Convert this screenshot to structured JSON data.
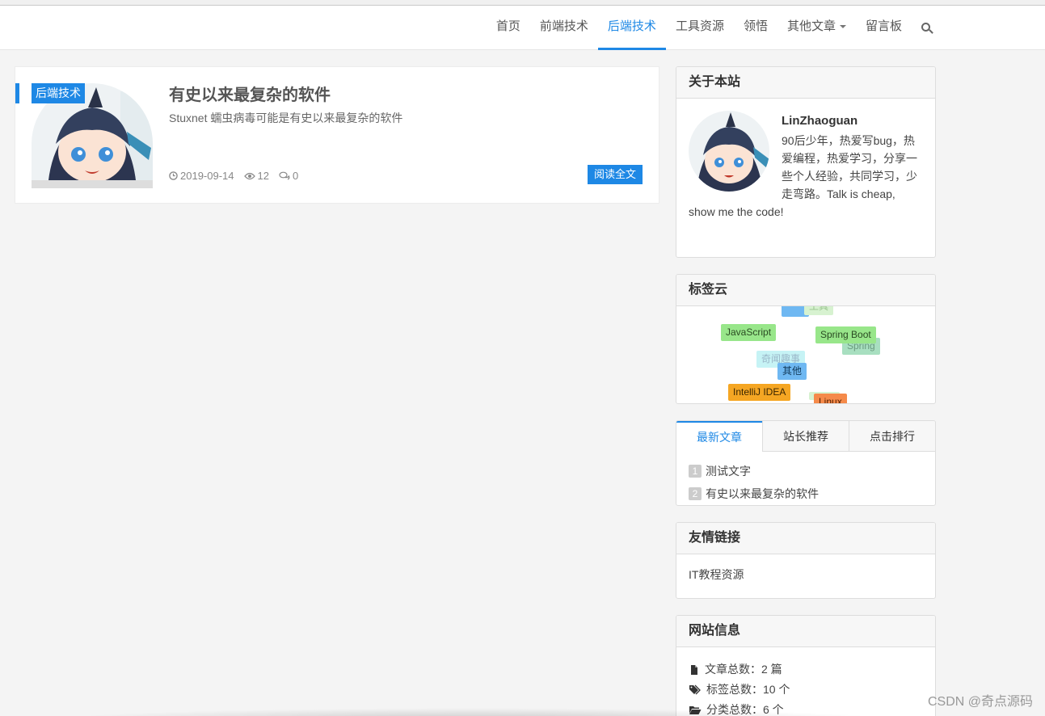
{
  "nav": {
    "items": [
      {
        "label": "首页",
        "active": false
      },
      {
        "label": "前端技术",
        "active": false
      },
      {
        "label": "后端技术",
        "active": true
      },
      {
        "label": "工具资源",
        "active": false
      },
      {
        "label": "领悟",
        "active": false
      },
      {
        "label": "其他文章",
        "active": false,
        "dropdown": true
      },
      {
        "label": "留言板",
        "active": false
      }
    ],
    "search_icon": "search-icon"
  },
  "article": {
    "category": "后端技术",
    "title": "有史以来最复杂的软件",
    "description": "Stuxnet 蠕虫病毒可能是有史以来最复杂的软件",
    "date": "2019-09-14",
    "views": "12",
    "comments": "0",
    "read_more": "阅读全文"
  },
  "about": {
    "title": "关于本站",
    "name": "LinZhaoguan",
    "bio": "90后少年，热爱写bug，热爱编程，热爱学习，分享一些个人经验，共同学习，少走弯路。Talk is cheap, show me the code!"
  },
  "tag_cloud": {
    "title": "标签云",
    "tags": [
      {
        "label": "工具",
        "color": "#d7f2d0",
        "text": "#9ac48f"
      },
      {
        "label": "JavaScript",
        "color": "#98e68a",
        "text": "#2a4a22"
      },
      {
        "label": "Spring Boot",
        "color": "#98e68a",
        "text": "#2a4a22"
      },
      {
        "label": "Spring",
        "color": "#a8dfc0",
        "text": "#6a9a7e"
      },
      {
        "label": "奇闻趣事",
        "color": "#c6f3f5",
        "text": "#9ad"
      },
      {
        "label": "其他",
        "color": "#6fb8f2",
        "text": "#123a5a"
      },
      {
        "label": "IntelliJ IDEA",
        "color": "#f5a623",
        "text": "#3a2500"
      },
      {
        "label": "Linux",
        "color": "#f58a4a",
        "text": "#5a2200"
      }
    ]
  },
  "article_tabs": {
    "tabs": [
      {
        "label": "最新文章",
        "active": true
      },
      {
        "label": "站长推荐",
        "active": false
      },
      {
        "label": "点击排行",
        "active": false
      }
    ],
    "items": [
      {
        "num": "1",
        "label": "测试文字"
      },
      {
        "num": "2",
        "label": "有史以来最复杂的软件"
      }
    ]
  },
  "links": {
    "title": "友情链接",
    "items": [
      {
        "label": "IT教程资源"
      }
    ]
  },
  "site_info": {
    "title": "网站信息",
    "items": [
      {
        "icon": "file-icon",
        "label": "文章总数：2 篇"
      },
      {
        "icon": "tags-icon",
        "label": "标签总数：10 个"
      },
      {
        "icon": "folder-open-icon",
        "label": "分类总数：6 个"
      }
    ]
  },
  "watermark": "CSDN @奇点源码",
  "colors": {
    "accent": "#1e88e5",
    "background": "#f4f4f4"
  }
}
